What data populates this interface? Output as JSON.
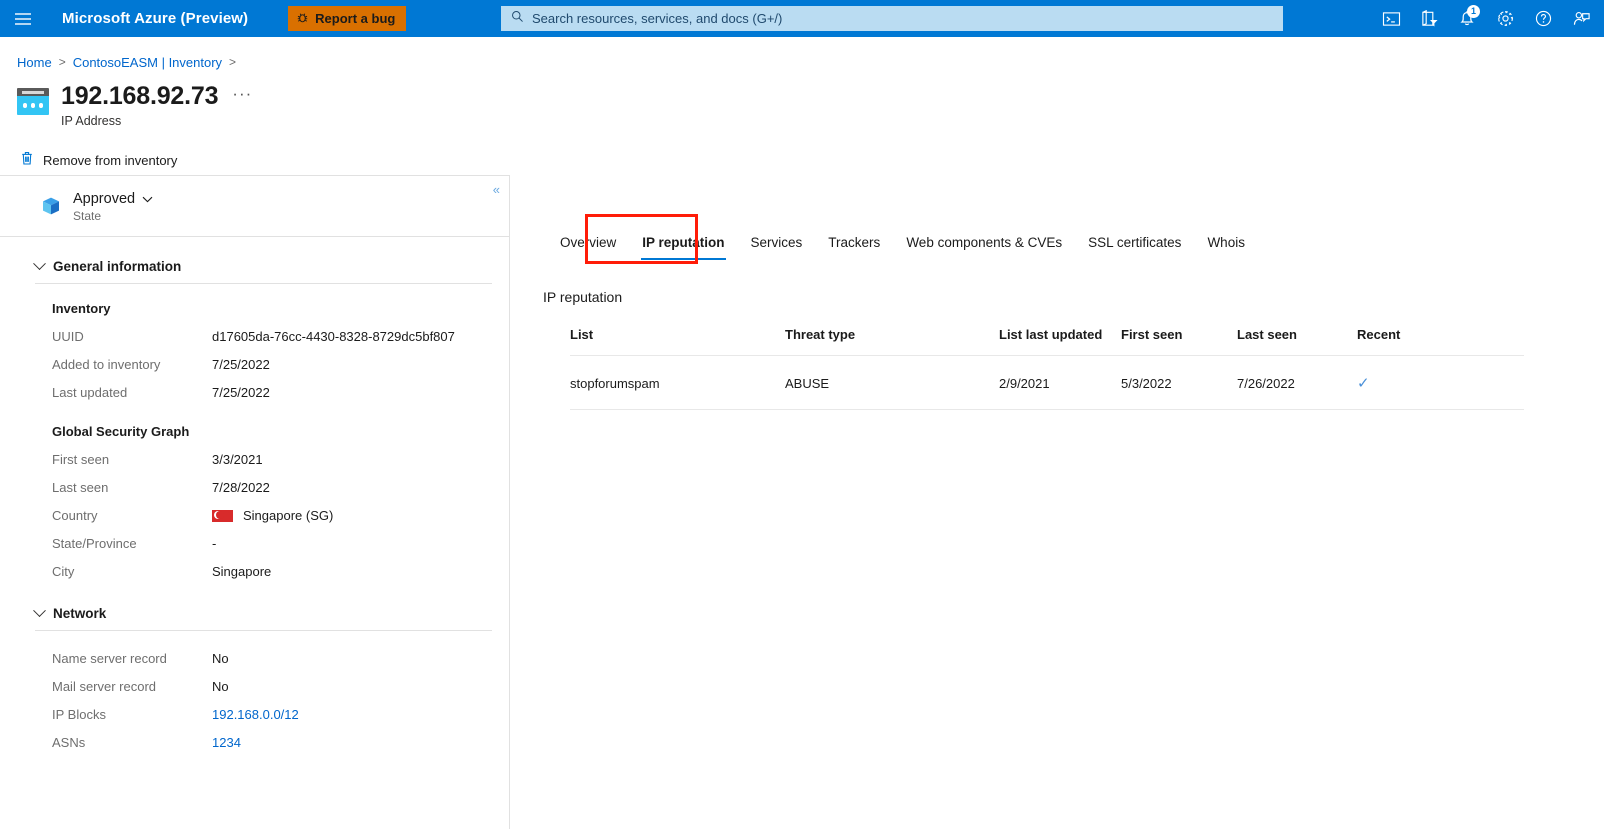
{
  "topbar": {
    "menu_icon": "hamburger-icon",
    "brand": "Microsoft Azure (Preview)",
    "report_bug_label": "Report a bug",
    "search_placeholder": "Search resources, services, and docs (G+/)",
    "search_value": "",
    "icons": [
      {
        "name": "cloud-shell-icon",
        "glyph": ">_"
      },
      {
        "name": "directory-filter-icon",
        "glyph": "filter"
      },
      {
        "name": "notifications-icon",
        "glyph": "bell",
        "badge": "1"
      },
      {
        "name": "settings-gear-icon",
        "glyph": "gear"
      },
      {
        "name": "help-icon",
        "glyph": "?"
      },
      {
        "name": "feedback-icon",
        "glyph": "person"
      }
    ],
    "accent_color": "#0078d4",
    "bug_button_color": "#d97000"
  },
  "breadcrumb": {
    "items": [
      {
        "label": "Home"
      },
      {
        "label": "ContosoEASM | Inventory"
      }
    ],
    "separator": ">"
  },
  "page": {
    "title": "192.168.92.73",
    "subtitle": "IP Address",
    "more_actions": "···",
    "icon": "ip-address-icon"
  },
  "commandbar": {
    "remove_label": "Remove from inventory",
    "remove_icon": "trash-icon"
  },
  "state": {
    "value": "Approved",
    "label": "State",
    "icon": "resource-cube-icon",
    "collapse_glyph": "«"
  },
  "left_panel": {
    "sections": [
      {
        "name": "general-information",
        "title": "General information",
        "groups": [
          {
            "title": "Inventory",
            "rows": [
              {
                "key": "UUID",
                "value": "d17605da-76cc-4430-8328-8729dc5bf807",
                "type": "text"
              },
              {
                "key": "Added to inventory",
                "value": "7/25/2022",
                "type": "text"
              },
              {
                "key": "Last updated",
                "value": "7/25/2022",
                "type": "text"
              }
            ]
          },
          {
            "title": "Global Security Graph",
            "rows": [
              {
                "key": "First seen",
                "value": "3/3/2021",
                "type": "text"
              },
              {
                "key": "Last seen",
                "value": "7/28/2022",
                "type": "text"
              },
              {
                "key": "Country",
                "value": "Singapore (SG)",
                "type": "flag"
              },
              {
                "key": "State/Province",
                "value": "-",
                "type": "text"
              },
              {
                "key": "City",
                "value": "Singapore",
                "type": "text"
              }
            ]
          }
        ]
      },
      {
        "name": "network",
        "title": "Network",
        "groups": [
          {
            "title": "",
            "rows": [
              {
                "key": "Name server record",
                "value": "No",
                "type": "text"
              },
              {
                "key": "Mail server record",
                "value": "No",
                "type": "text"
              },
              {
                "key": "IP Blocks",
                "value": "192.168.0.0/12",
                "type": "link"
              },
              {
                "key": "ASNs",
                "value": "1234",
                "type": "link"
              }
            ]
          }
        ]
      }
    ]
  },
  "main": {
    "tabs": [
      {
        "label": "Overview",
        "active": false
      },
      {
        "label": "IP reputation",
        "active": true
      },
      {
        "label": "Services",
        "active": false
      },
      {
        "label": "Trackers",
        "active": false
      },
      {
        "label": "Web components & CVEs",
        "active": false
      },
      {
        "label": "SSL certificates",
        "active": false
      },
      {
        "label": "Whois",
        "active": false
      }
    ],
    "content_title": "IP reputation",
    "table": {
      "columns": [
        "List",
        "Threat type",
        "List last updated",
        "First seen",
        "Last seen",
        "Recent"
      ],
      "rows": [
        {
          "list": "stopforumspam",
          "threat_type": "ABUSE",
          "list_last_updated": "2/9/2021",
          "first_seen": "5/3/2022",
          "last_seen": "7/26/2022",
          "recent": "✓"
        }
      ]
    },
    "annotation_color": "#ff1c08"
  }
}
